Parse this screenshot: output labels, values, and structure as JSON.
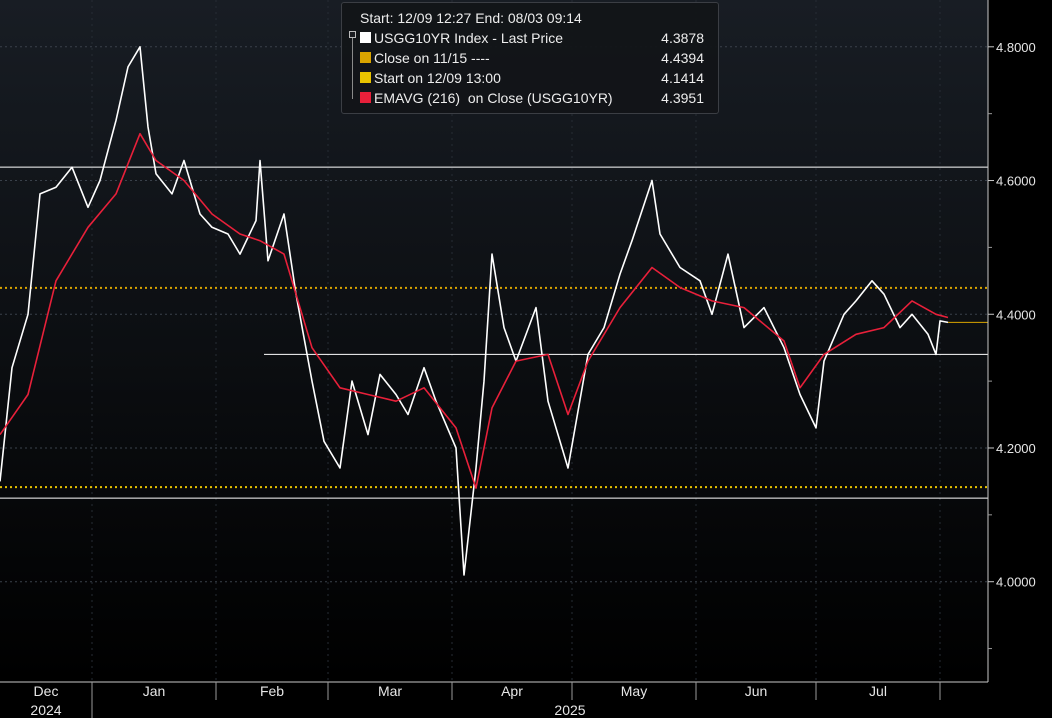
{
  "header": {
    "range": "Start: 12/09 12:27 End: 08/03 09:14"
  },
  "legend": {
    "items": [
      {
        "label": "USGG10YR Index - Last Price",
        "value": "4.3878",
        "color": "#ffffff"
      },
      {
        "label": "Close on 11/15 ----",
        "value": "4.4394",
        "color": "#d9a400"
      },
      {
        "label": "Start on 12/09 13:00",
        "value": "4.1414",
        "color": "#e8c300"
      },
      {
        "label": "EMAVG (216)  on Close (USGG10YR)",
        "value": "4.3951",
        "color": "#e8203a"
      }
    ]
  },
  "chart_data": {
    "type": "line",
    "title": "",
    "xlabel": "",
    "ylabel": "",
    "ylim": [
      3.85,
      4.87
    ],
    "grid": true,
    "legend_position": "top-center",
    "y_ticks": [
      "4.8000",
      "4.6000",
      "4.4000",
      "4.2000",
      "4.0000"
    ],
    "x_ticks": [
      "Dec",
      "Jan",
      "Feb",
      "Mar",
      "Apr",
      "May",
      "Jun",
      "Jul"
    ],
    "x_years": [
      "2024",
      "2025"
    ],
    "colors": {
      "price": "#ffffff",
      "ema": "#e8203a",
      "close_line": "#d9a400",
      "start_line": "#e8c300",
      "level_line": "#ffffff"
    },
    "horizontal_lines": [
      {
        "name": "Close on 11/15",
        "value": 4.4394,
        "style": "dotted",
        "color": "#d9a400"
      },
      {
        "name": "Start on 12/09 13:00",
        "value": 4.1414,
        "style": "dotted",
        "color": "#e8c300"
      },
      {
        "name": "level-4.62",
        "value": 4.62,
        "style": "solid",
        "color": "#ffffff"
      },
      {
        "name": "level-4.34",
        "value": 4.34,
        "style": "solid",
        "color": "#ffffff"
      },
      {
        "name": "level-4.125",
        "value": 4.125,
        "style": "solid",
        "color": "#ffffff"
      }
    ],
    "last_value": 4.3878,
    "series": [
      {
        "name": "USGG10YR Index - Last Price",
        "x": [
          "2024-12-09",
          "2024-12-12",
          "2024-12-16",
          "2024-12-19",
          "2024-12-23",
          "2024-12-27",
          "2024-12-31",
          "2025-01-03",
          "2025-01-07",
          "2025-01-10",
          "2025-01-13",
          "2025-01-15",
          "2025-01-17",
          "2025-01-21",
          "2025-01-24",
          "2025-01-28",
          "2025-01-31",
          "2025-02-04",
          "2025-02-07",
          "2025-02-11",
          "2025-02-12",
          "2025-02-14",
          "2025-02-18",
          "2025-02-21",
          "2025-02-25",
          "2025-02-28",
          "2025-03-04",
          "2025-03-07",
          "2025-03-11",
          "2025-03-14",
          "2025-03-18",
          "2025-03-21",
          "2025-03-25",
          "2025-03-28",
          "2025-04-02",
          "2025-04-04",
          "2025-04-07",
          "2025-04-09",
          "2025-04-11",
          "2025-04-14",
          "2025-04-17",
          "2025-04-22",
          "2025-04-25",
          "2025-04-30",
          "2025-05-05",
          "2025-05-09",
          "2025-05-13",
          "2025-05-16",
          "2025-05-21",
          "2025-05-23",
          "2025-05-28",
          "2025-06-02",
          "2025-06-05",
          "2025-06-09",
          "2025-06-13",
          "2025-06-18",
          "2025-06-23",
          "2025-06-27",
          "2025-07-01",
          "2025-07-03",
          "2025-07-08",
          "2025-07-11",
          "2025-07-15",
          "2025-07-18",
          "2025-07-22",
          "2025-07-25",
          "2025-07-29",
          "2025-07-31",
          "2025-08-01",
          "2025-08-03"
        ],
        "y": [
          4.15,
          4.32,
          4.4,
          4.58,
          4.59,
          4.62,
          4.56,
          4.6,
          4.69,
          4.77,
          4.8,
          4.68,
          4.61,
          4.58,
          4.63,
          4.55,
          4.53,
          4.52,
          4.49,
          4.54,
          4.63,
          4.48,
          4.55,
          4.43,
          4.3,
          4.21,
          4.17,
          4.3,
          4.22,
          4.31,
          4.28,
          4.25,
          4.32,
          4.27,
          4.2,
          4.01,
          4.17,
          4.3,
          4.49,
          4.38,
          4.33,
          4.41,
          4.27,
          4.17,
          4.34,
          4.38,
          4.46,
          4.51,
          4.6,
          4.52,
          4.47,
          4.45,
          4.4,
          4.49,
          4.38,
          4.41,
          4.35,
          4.28,
          4.23,
          4.33,
          4.4,
          4.42,
          4.45,
          4.43,
          4.38,
          4.4,
          4.37,
          4.34,
          4.39,
          4.3878
        ]
      },
      {
        "name": "EMAVG (216)  on Close (USGG10YR)",
        "x": [
          "2024-12-09",
          "2024-12-16",
          "2024-12-23",
          "2024-12-31",
          "2025-01-07",
          "2025-01-13",
          "2025-01-17",
          "2025-01-24",
          "2025-01-31",
          "2025-02-07",
          "2025-02-12",
          "2025-02-18",
          "2025-02-25",
          "2025-03-04",
          "2025-03-11",
          "2025-03-18",
          "2025-03-25",
          "2025-04-02",
          "2025-04-07",
          "2025-04-11",
          "2025-04-17",
          "2025-04-25",
          "2025-04-30",
          "2025-05-05",
          "2025-05-13",
          "2025-05-21",
          "2025-05-28",
          "2025-06-05",
          "2025-06-13",
          "2025-06-23",
          "2025-06-27",
          "2025-07-03",
          "2025-07-11",
          "2025-07-18",
          "2025-07-25",
          "2025-07-31",
          "2025-08-03"
        ],
        "y": [
          4.22,
          4.28,
          4.45,
          4.53,
          4.58,
          4.67,
          4.63,
          4.6,
          4.55,
          4.52,
          4.51,
          4.49,
          4.35,
          4.29,
          4.28,
          4.27,
          4.29,
          4.23,
          4.14,
          4.26,
          4.33,
          4.34,
          4.25,
          4.33,
          4.41,
          4.47,
          4.44,
          4.42,
          4.41,
          4.36,
          4.29,
          4.34,
          4.37,
          4.38,
          4.42,
          4.4,
          4.3951
        ]
      }
    ]
  }
}
